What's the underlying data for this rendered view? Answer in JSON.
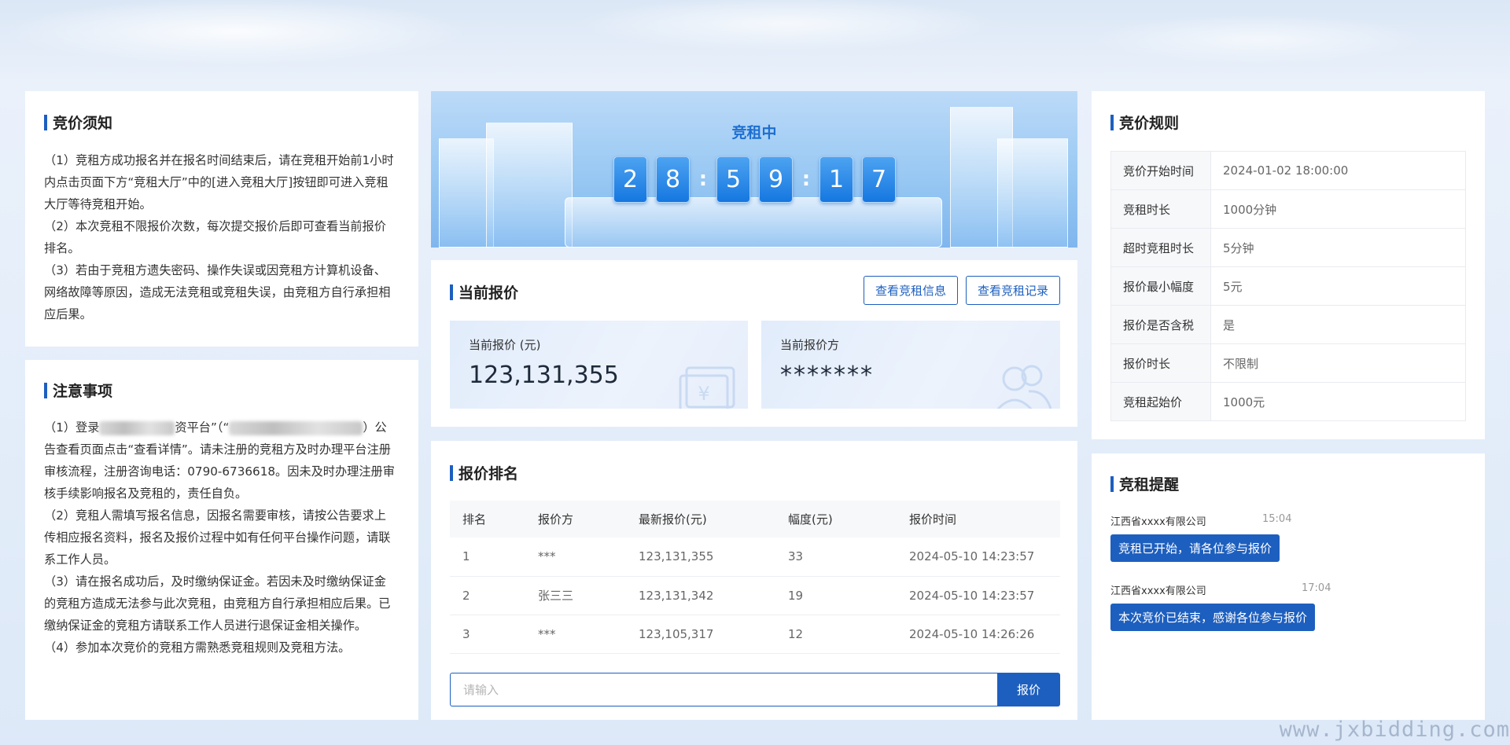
{
  "notice": {
    "title": "竞价须知",
    "items": [
      "（1）竞租方成功报名并在报名时间结束后，请在竞租开始前1小时内点击页面下方“竞租大厅”中的[进入竞租大厅]按钮即可进入竞租大厅等待竞租开始。",
      "（2）本次竞租不限报价次数，每次提交报价后即可查看当前报价排名。",
      "（3）若由于竞租方遗失密码、操作失误或因竞租方计算机设备、网络故障等原因，造成无法竞租或竞租失误，由竞租方自行承担相应后果。"
    ]
  },
  "matters": {
    "title": "注意事项",
    "item1_prefix": "（1）登录",
    "item1_platform_suffix": "资平台”（“",
    "item1_close": "）",
    "item1_rest": "公告查看页面点击“查看详情”。请未注册的竞租方及时办理平台注册审核流程，注册咨询电话：0790-6736618。因未及时办理注册审核手续影响报名及竞租的，责任自负。",
    "items": [
      "（2）竞租人需填写报名信息，因报名需要审核，请按公告要求上传相应报名资料，报名及报价过程中如有任何平台操作问题，请联系工作人员。",
      "（3）请在报名成功后，及时缴纳保证金。若因未及时缴纳保证金的竞租方造成无法参与此次竞租，由竞租方自行承担相应后果。已缴纳保证金的竞租方请联系工作人员进行退保证金相关操作。",
      "（4）参加本次竞价的竞租方需熟悉竞租规则及竞租方法。"
    ]
  },
  "banner": {
    "status": "竞租中",
    "timer": {
      "h1": "2",
      "h2": "8",
      "m1": "5",
      "m2": "9",
      "s1": "1",
      "s2": "7",
      "sep": ":"
    }
  },
  "current_bid": {
    "title": "当前报价",
    "btn_info": "查看竞租信息",
    "btn_record": "查看竞租记录",
    "price_label": "当前报价 (元)",
    "price_value": "123,131,355",
    "bidder_label": "当前报价方",
    "bidder_value": "*******"
  },
  "ranking": {
    "title": "报价排名",
    "headers": [
      "排名",
      "报价方",
      "最新报价(元)",
      "幅度(元)",
      "报价时间"
    ],
    "rows": [
      [
        "1",
        "***",
        "123,131,355",
        "33",
        "2024-05-10 14:23:57"
      ],
      [
        "2",
        "张三三",
        "123,131,342",
        "19",
        "2024-05-10 14:23:57"
      ],
      [
        "3",
        "***",
        "123,105,317",
        "12",
        "2024-05-10 14:26:26"
      ]
    ],
    "input_placeholder": "请输入",
    "submit_label": "报价"
  },
  "rules": {
    "title": "竞价规则",
    "rows": [
      [
        "竞价开始时间",
        "2024-01-02 18:00:00"
      ],
      [
        "竞租时长",
        "1000分钟"
      ],
      [
        "超时竞租时长",
        "5分钟"
      ],
      [
        "报价最小幅度",
        "5元"
      ],
      [
        "报价是否含税",
        "是"
      ],
      [
        "报价时长",
        "不限制"
      ],
      [
        "竞租起始价",
        "1000元"
      ]
    ]
  },
  "reminders": {
    "title": "竞租提醒",
    "messages": [
      {
        "from": "江西省xxxx有限公司",
        "time": "15:04",
        "text": "竞租已开始，请各位参与报价"
      },
      {
        "from": "江西省xxxx有限公司",
        "time": "17:04",
        "text": "本次竞价已结束，感谢各位参与报价"
      }
    ]
  },
  "watermark": "www.jxbidding.com",
  "colors": {
    "accent": "#1d5fbf",
    "timer_digit": "#1577e0"
  }
}
